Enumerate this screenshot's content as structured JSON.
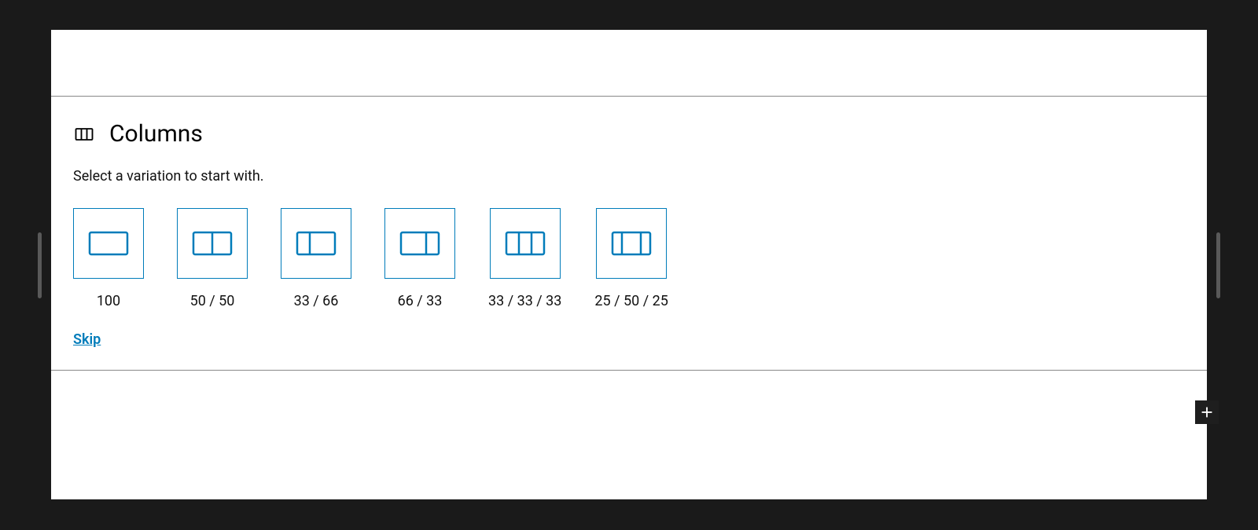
{
  "block": {
    "title": "Columns",
    "instructions": "Select a variation to start with.",
    "skip_label": "Skip"
  },
  "variations": [
    {
      "label": "100"
    },
    {
      "label": "50 / 50"
    },
    {
      "label": "33 / 66"
    },
    {
      "label": "66 / 33"
    },
    {
      "label": "33 / 33 / 33"
    },
    {
      "label": "25 / 50 / 25"
    }
  ],
  "colors": {
    "accent": "#007cba"
  }
}
